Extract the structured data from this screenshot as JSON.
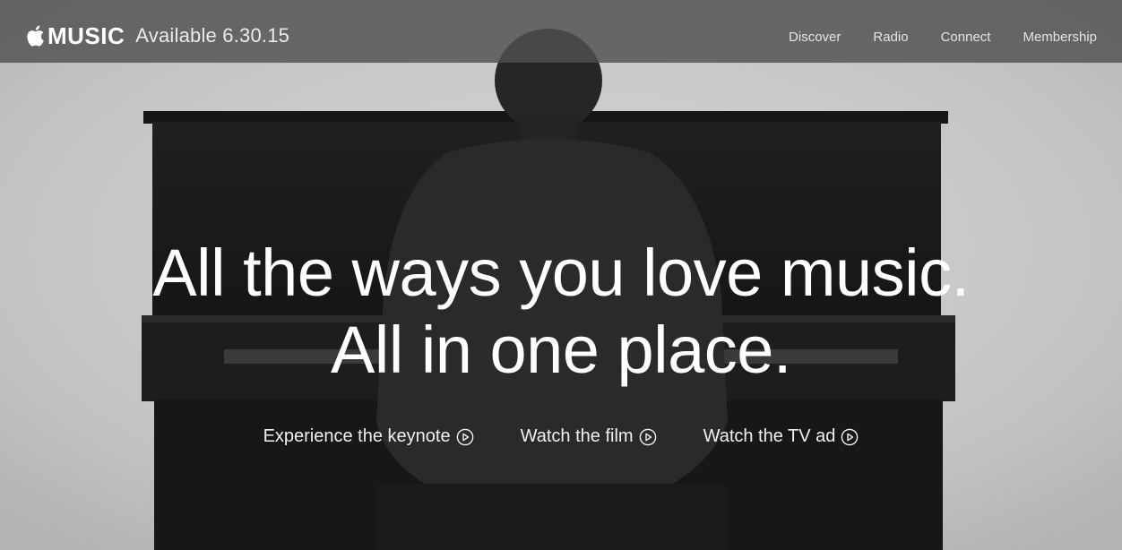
{
  "brand": {
    "logo_icon": "apple-icon",
    "name": "MUSIC",
    "availability": "Available 6.30.15"
  },
  "nav": {
    "items": [
      {
        "label": "Discover"
      },
      {
        "label": "Radio"
      },
      {
        "label": "Connect"
      },
      {
        "label": "Membership"
      }
    ]
  },
  "hero": {
    "headline_line1": "All the ways you love music.",
    "headline_line2": "All in one place."
  },
  "links": [
    {
      "label": "Experience the keynote",
      "icon": "play-circle-icon"
    },
    {
      "label": "Watch the film",
      "icon": "play-circle-icon"
    },
    {
      "label": "Watch the TV ad",
      "icon": "play-circle-icon"
    }
  ],
  "colors": {
    "topbar": "#505050",
    "text": "#ffffff",
    "piano": "#1c1c1c",
    "background": "#c8c8c8"
  }
}
